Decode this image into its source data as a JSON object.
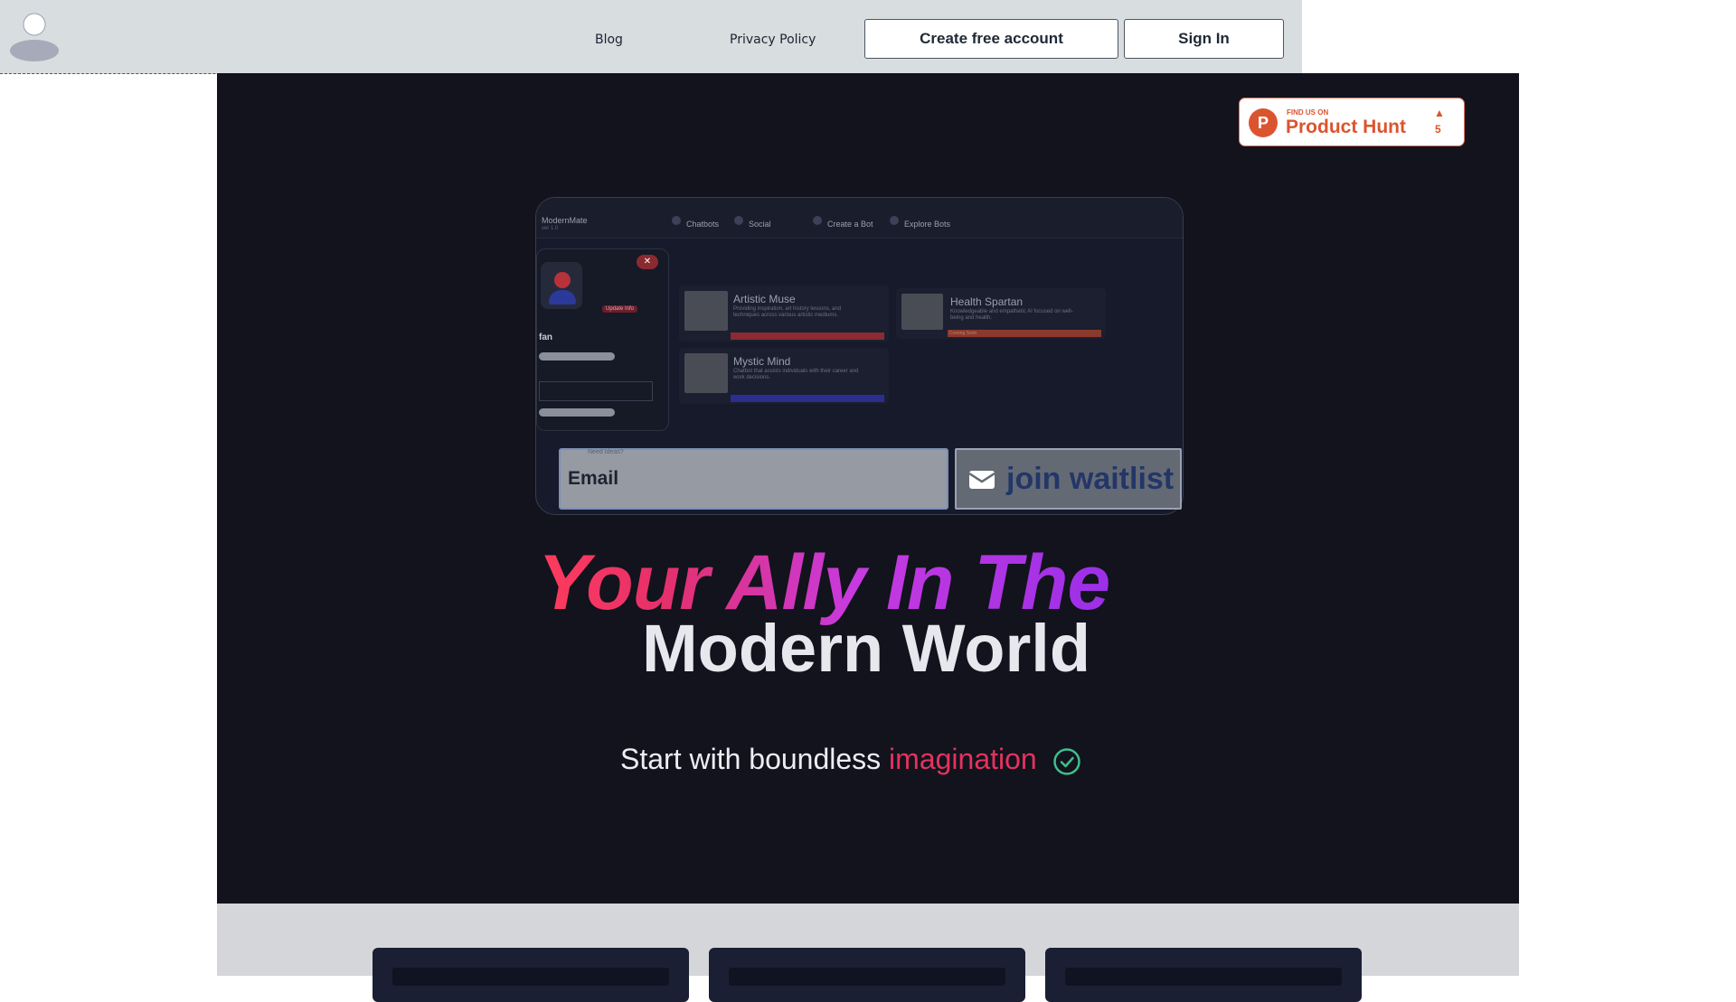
{
  "nav": {
    "links": [
      "Blog",
      "Privacy Policy"
    ],
    "create_account_label": "Create free account",
    "sign_in_label": "Sign In",
    "avatar_icon": "user-avatar-icon"
  },
  "product_hunt": {
    "small_text": "FIND US ON",
    "name": "Product Hunt",
    "logo_letter": "P",
    "arrow": "▲",
    "count": "5"
  },
  "preview": {
    "brand": "ModernMate",
    "brand_sub": "ver 1.0",
    "nav_items": [
      "Chatbots",
      "Social",
      "Create a Bot",
      "Explore Bots"
    ],
    "close_glyph": "✕",
    "update_label": "Update Info",
    "profile_name": "fan",
    "cards": [
      {
        "title": "Artistic Muse",
        "desc": "Providing inspiration, art history lessons, and techniques across various artistic mediums."
      },
      {
        "title": "Mystic Mind",
        "desc": "Chatbot that assists individuals with their career and work decisions."
      },
      {
        "title": "Health Spartan",
        "desc": "Knowledgeable and empathetic AI focused on well-being and health."
      }
    ],
    "coming_soon": "Coming Soon"
  },
  "waitlist": {
    "email_value": "Email",
    "email_hint": "Need Ideas?",
    "button_label": "join waitlist",
    "button_icon": "envelope-icon"
  },
  "hero": {
    "headline_line1": "Your Ally In The",
    "headline_line2": "Modern World",
    "sub_prefix": "Start with boundless",
    "sub_accent": "imagination",
    "sub_icon": "check-circle-icon"
  },
  "colors": {
    "hero_bg": "#12131c",
    "accent": "#e5325f",
    "check": "#3fbf8f",
    "product_hunt": "#da552f"
  }
}
